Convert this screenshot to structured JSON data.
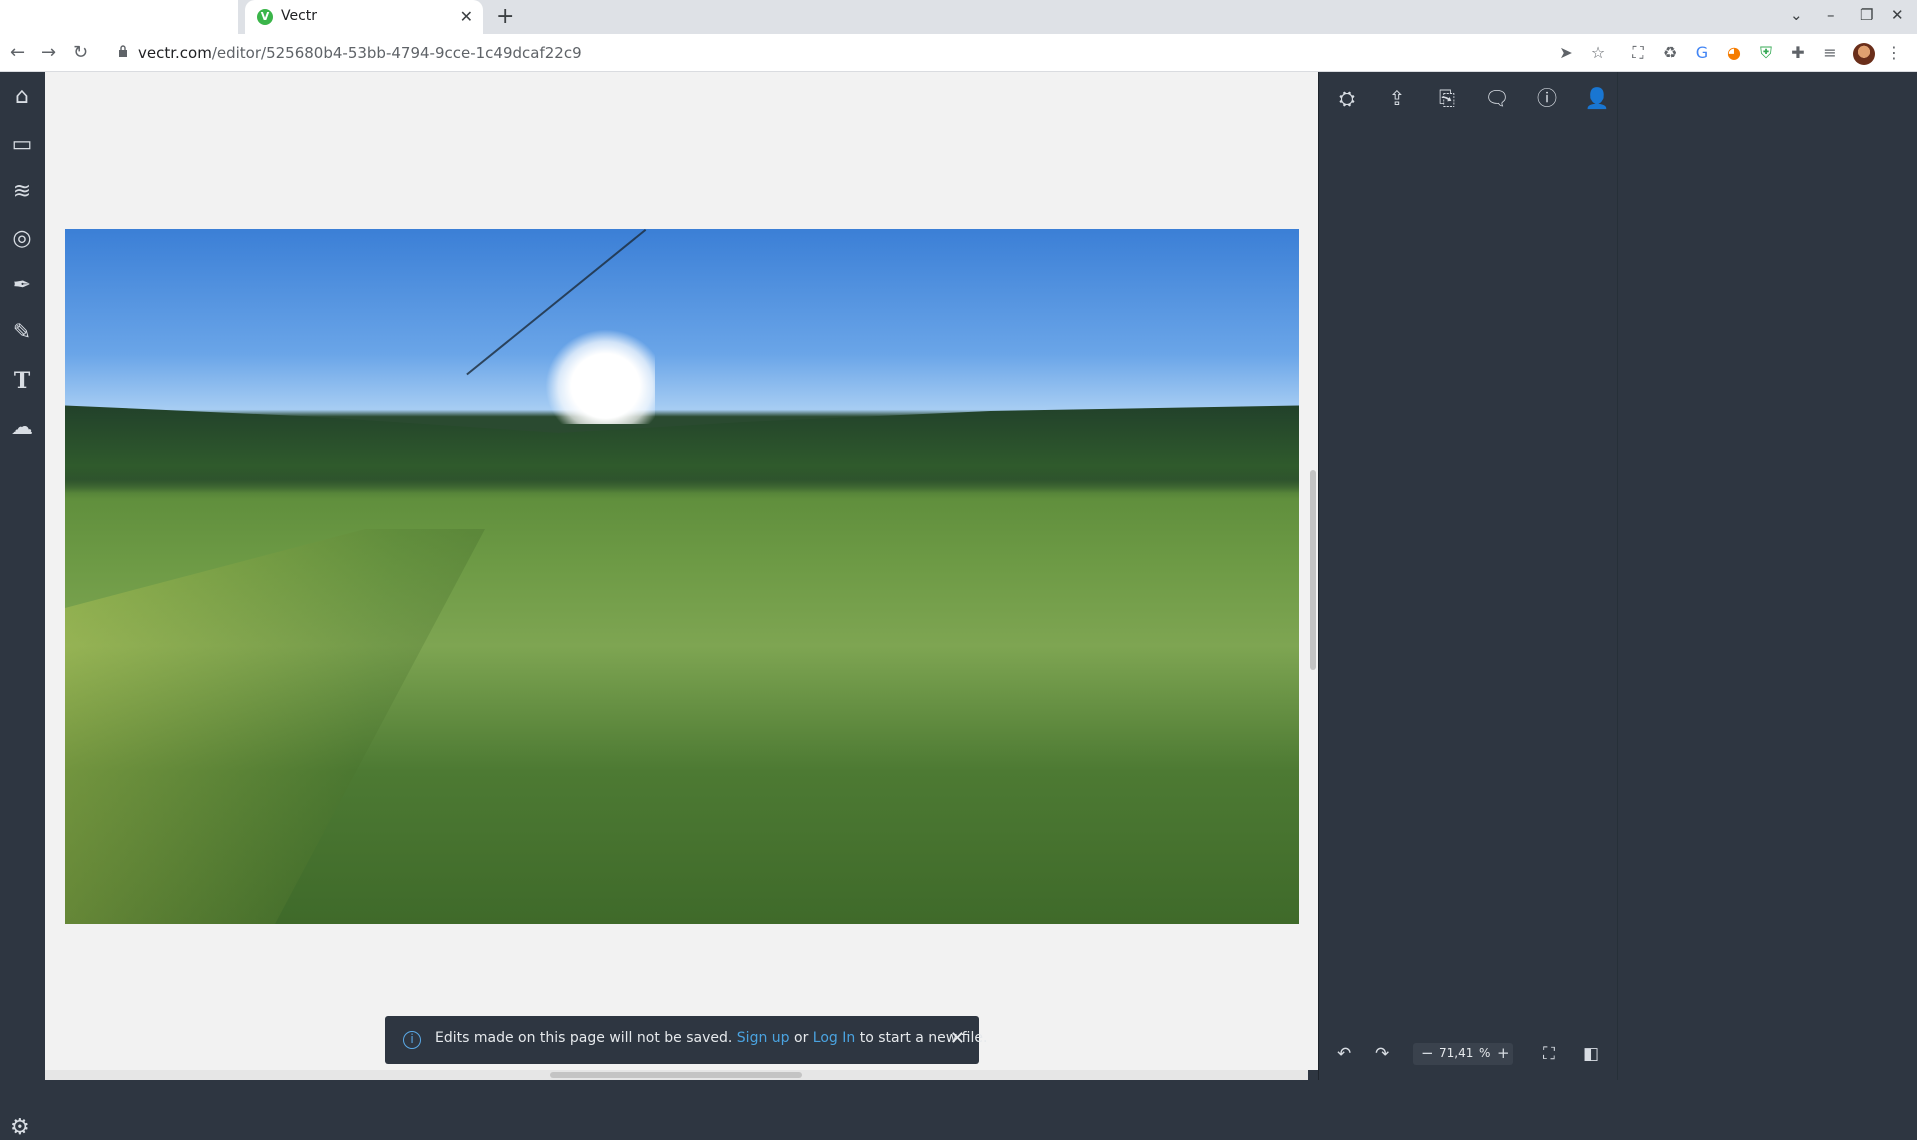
{
  "browser": {
    "tab_title": "Vectr",
    "tab_favicon": "V",
    "url_host": "vectr.com",
    "url_path": "/editor/525680b4-53bb-4794-9cce-1c49dcaf22c9"
  },
  "left_tools": [
    {
      "name": "home-icon",
      "glyph": "⌂"
    },
    {
      "name": "pages-icon",
      "glyph": "▭"
    },
    {
      "name": "layers-icon",
      "glyph": "≋"
    },
    {
      "name": "shapes-icon",
      "glyph": "◎"
    },
    {
      "name": "pen-tool-icon",
      "glyph": "✒"
    },
    {
      "name": "pencil-icon",
      "glyph": "✎"
    },
    {
      "name": "text-tool-icon",
      "glyph": "T"
    },
    {
      "name": "upload-cloud-icon",
      "glyph": "☁"
    }
  ],
  "right_tools": [
    {
      "name": "export-icon",
      "glyph": "⛭"
    },
    {
      "name": "upload-icon",
      "glyph": "⇪"
    },
    {
      "name": "new-document-icon",
      "glyph": "⎘"
    },
    {
      "name": "comments-icon",
      "glyph": "💬"
    },
    {
      "name": "info-icon",
      "glyph": "ⓘ"
    },
    {
      "name": "user-icon",
      "glyph": "👤"
    }
  ],
  "zoom": {
    "value": "71,41",
    "unit": "%"
  },
  "toast": {
    "text_before": "Edits made on this page will not be saved.",
    "signup": "Sign up",
    "or": "or",
    "login": "Log In",
    "text_after": "to start a new file."
  },
  "colors": {
    "panel_bg": "#2e3641",
    "link": "#4aa3e0",
    "canvas_bg": "#f2f2f2"
  }
}
